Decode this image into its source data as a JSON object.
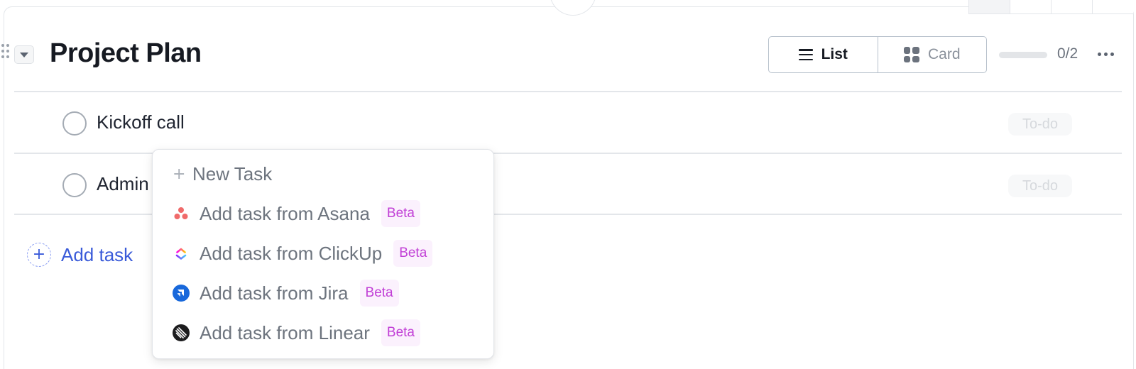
{
  "section": {
    "title": "Project Plan",
    "view_options": [
      {
        "label": "List",
        "active": true
      },
      {
        "label": "Card",
        "active": false
      }
    ],
    "progress": {
      "completed": 0,
      "total": 2,
      "text": "0/2"
    }
  },
  "tasks": [
    {
      "name": "Kickoff call",
      "status": "To-do"
    },
    {
      "name": "Admin",
      "status": "To-do"
    }
  ],
  "add_task_label": "Add task",
  "menu": {
    "new_task_label": "New Task",
    "integrations": [
      {
        "label": "Add task from Asana",
        "badge": "Beta",
        "icon": "asana-icon"
      },
      {
        "label": "Add task from ClickUp",
        "badge": "Beta",
        "icon": "clickup-icon"
      },
      {
        "label": "Add task from Jira",
        "badge": "Beta",
        "icon": "jira-icon"
      },
      {
        "label": "Add task from Linear",
        "badge": "Beta",
        "icon": "linear-icon"
      }
    ]
  },
  "colors": {
    "accent": "#3a5bd9",
    "beta_text": "#c13fd6",
    "beta_bg": "#fbf1fd"
  }
}
